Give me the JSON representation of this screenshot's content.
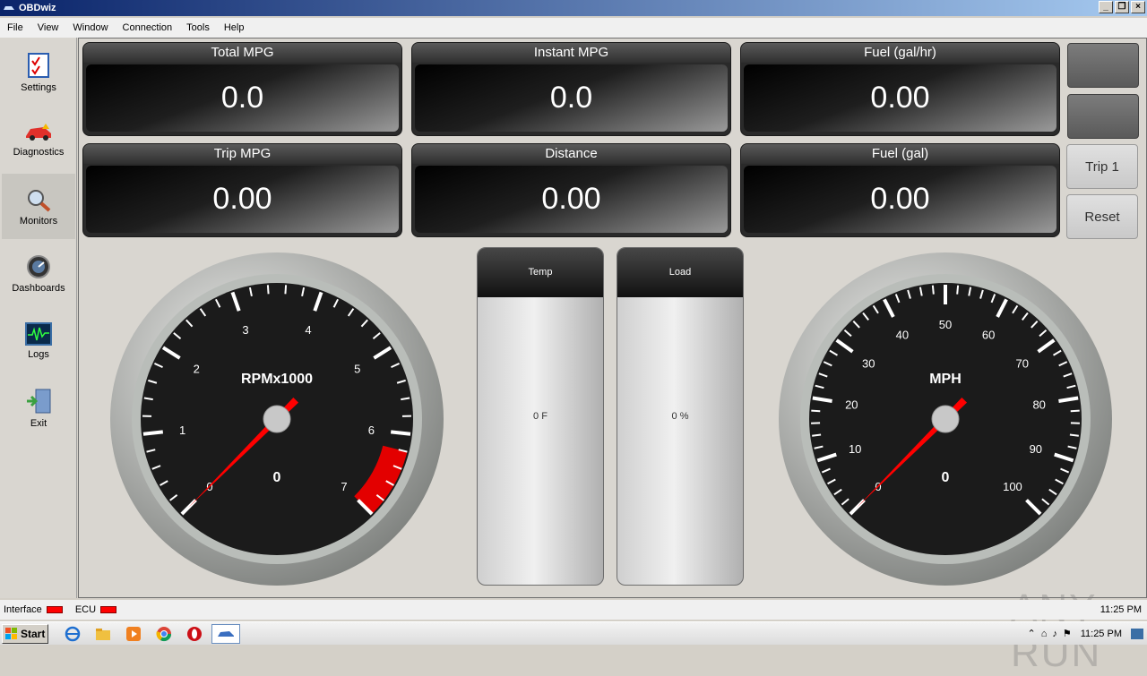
{
  "window": {
    "title": "OBDwiz"
  },
  "menu": [
    "File",
    "View",
    "Window",
    "Connection",
    "Tools",
    "Help"
  ],
  "sidebar": [
    {
      "label": "Settings",
      "icon": "settings-checklist-icon"
    },
    {
      "label": "Diagnostics",
      "icon": "car-icon"
    },
    {
      "label": "Monitors",
      "icon": "magnifier-icon"
    },
    {
      "label": "Dashboards",
      "icon": "gauge-icon"
    },
    {
      "label": "Logs",
      "icon": "waveform-icon"
    },
    {
      "label": "Exit",
      "icon": "exit-door-icon"
    }
  ],
  "panels": [
    {
      "label": "Total MPG",
      "value": "0.0"
    },
    {
      "label": "Instant MPG",
      "value": "0.0"
    },
    {
      "label": "Fuel (gal/hr)",
      "value": "0.00"
    },
    {
      "label": "Trip MPG",
      "value": "0.00"
    },
    {
      "label": "Distance",
      "value": "0.00"
    },
    {
      "label": "Fuel (gal)",
      "value": "0.00"
    }
  ],
  "buttons": {
    "trip": "Trip 1",
    "reset": "Reset"
  },
  "bars": {
    "temp": {
      "label": "Temp",
      "value": "0 F",
      "level": 0
    },
    "load": {
      "label": "Load",
      "value": "0 %",
      "level": 0
    }
  },
  "rpm_gauge": {
    "title": "RPMx1000",
    "readout": "0",
    "min": 0,
    "max": 7,
    "value": 0,
    "ticks": [
      "0",
      "1",
      "2",
      "3",
      "4",
      "5",
      "6",
      "7"
    ],
    "redline_from": 6.2
  },
  "speed_gauge": {
    "title": "MPH",
    "readout": "0",
    "min": 0,
    "max": 100,
    "value": 0,
    "ticks": [
      "0",
      "10",
      "20",
      "30",
      "40",
      "50",
      "60",
      "70",
      "80",
      "90",
      "100"
    ]
  },
  "status": {
    "interface": "Interface",
    "ecu": "ECU",
    "time": "11:25 PM",
    "indicator_color": "#ff0000"
  },
  "taskbar": {
    "start": "Start",
    "clock": "11:25 PM"
  },
  "watermark": "ANY RUN"
}
